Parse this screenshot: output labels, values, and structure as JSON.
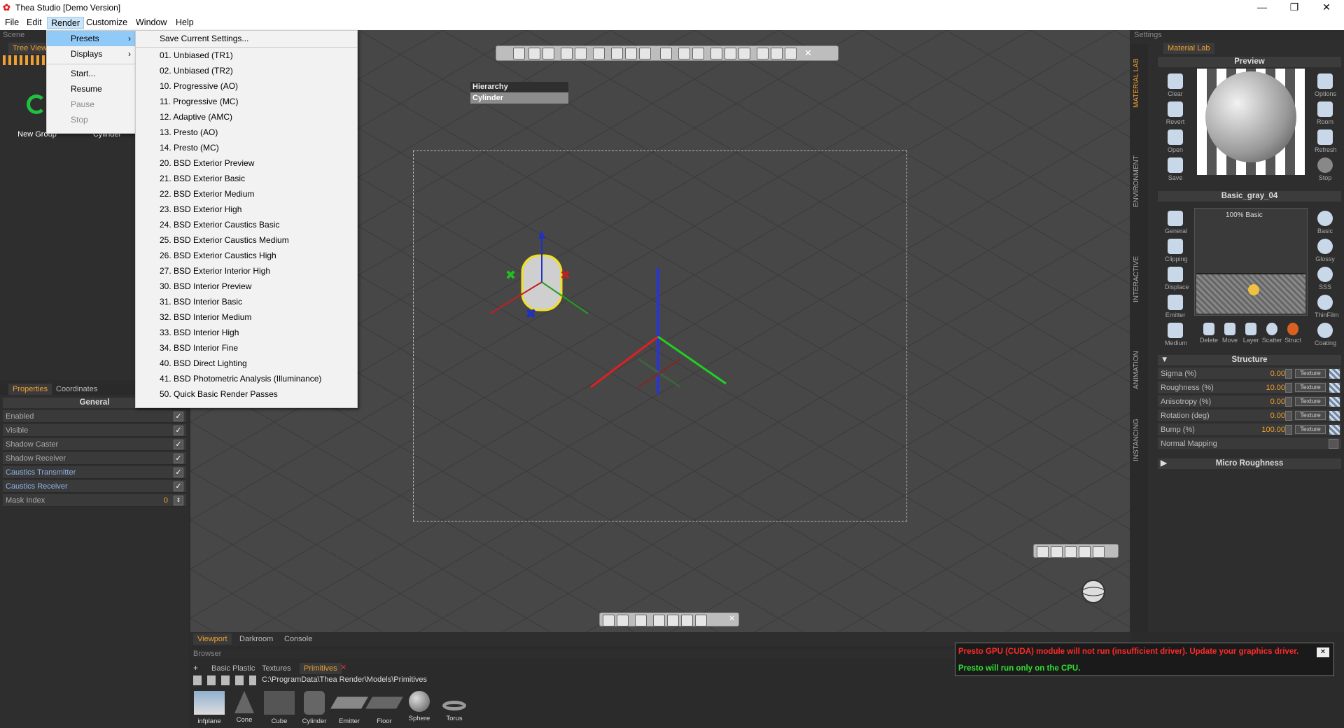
{
  "window": {
    "title": "Thea Studio [Demo Version]"
  },
  "menubar": {
    "items": [
      "File",
      "Edit",
      "Render",
      "Customize",
      "Window",
      "Help"
    ]
  },
  "scene": {
    "header": "Scene",
    "tree_tab": "Tree View",
    "items": [
      "New Group",
      "Cylinder"
    ]
  },
  "properties": {
    "tabs": [
      "Properties",
      "Coordinates"
    ],
    "section": "General",
    "rows": [
      {
        "label": "Enabled",
        "checked": "✓"
      },
      {
        "label": "Visible",
        "checked": "✓"
      },
      {
        "label": "Shadow Caster",
        "checked": "✓"
      },
      {
        "label": "Shadow Receiver",
        "checked": "✓"
      },
      {
        "label": "Caustics Transmitter",
        "checked": "✓"
      },
      {
        "label": "Caustics Receiver",
        "checked": "✓"
      }
    ],
    "mask_label": "Mask Index",
    "mask_value": "0"
  },
  "render_menu": {
    "items": [
      {
        "label": "Presets",
        "arrow": "›"
      },
      {
        "label": "Displays",
        "arrow": "›"
      },
      {
        "label": "Start..."
      },
      {
        "label": "Resume"
      },
      {
        "label": "Pause"
      },
      {
        "label": "Stop"
      }
    ]
  },
  "presets_menu": {
    "items": [
      "Save Current Settings...",
      "01. Unbiased (TR1)",
      "02. Unbiased (TR2)",
      "10. Progressive (AO)",
      "11. Progressive (MC)",
      "12. Adaptive (AMC)",
      "13. Presto (AO)",
      "14. Presto (MC)",
      "20. BSD Exterior Preview",
      "21. BSD Exterior Basic",
      "22. BSD Exterior Medium",
      "23. BSD Exterior High",
      "24. BSD Exterior Caustics Basic",
      "25. BSD Exterior Caustics Medium",
      "26. BSD Exterior Caustics High",
      "27. BSD Exterior Interior High",
      "30. BSD Interior Preview",
      "31. BSD Interior Basic",
      "32. BSD Interior Medium",
      "33. BSD Interior High",
      "34. BSD Interior Fine",
      "40. BSD Direct Lighting",
      "41. BSD Photometric Analysis (Illuminance)",
      "50. Quick Basic Render Passes"
    ]
  },
  "viewport": {
    "hierarchy_title": "Hierarchy",
    "hierarchy_item": "Cylinder",
    "tabs": [
      "Viewport",
      "Darkroom",
      "Console"
    ]
  },
  "settings": {
    "header": "Settings",
    "vtabs": [
      "MATERIAL LAB",
      "ENVIRONMENT",
      "INTERACTIVE",
      "ANIMATION",
      "INSTANCING"
    ],
    "material_tab": "Material Lab",
    "preview_title": "Preview",
    "left_buttons": [
      "Clear",
      "Revert",
      "Open",
      "Save"
    ],
    "right_buttons": [
      "Options",
      "Room",
      "Refresh",
      "Stop"
    ],
    "material_name": "Basic_gray_04",
    "layer_label": "100% Basic",
    "layer_left": [
      "General",
      "Clipping",
      "Displace",
      "Emitter",
      "Medium"
    ],
    "layer_right": [
      "Basic",
      "Glossy",
      "SSS",
      "ThinFilm",
      "Coating"
    ],
    "layer_bottom": [
      "Delete",
      "Move",
      "Layer",
      "Scatter",
      "Struct"
    ],
    "structure_title": "Structure",
    "structure": [
      {
        "label": "Sigma (%)",
        "value": "0.00",
        "tex": "Texture"
      },
      {
        "label": "Roughness (%)",
        "value": "10.00",
        "tex": "Texture"
      },
      {
        "label": "Anisotropy (%)",
        "value": "0.00",
        "tex": "Texture"
      },
      {
        "label": "Rotation (deg)",
        "value": "0.00",
        "tex": "Texture"
      },
      {
        "label": "Bump (%)",
        "value": "100.00",
        "tex": "Texture"
      }
    ],
    "normal_mapping": "Normal Mapping",
    "micro_roughness": "Micro Roughness"
  },
  "browser": {
    "header": "Browser",
    "tabs": [
      "Basic Plastic",
      "Textures",
      "Primitives"
    ],
    "path": "C:\\ProgramData\\Thea Render\\Models\\Primitives",
    "items": [
      "infplane",
      "Cone",
      "Cube",
      "Cylinder",
      "Emitter",
      "Floor",
      "Sphere",
      "Torus"
    ]
  },
  "notice": {
    "line1": "Presto GPU (CUDA) module will not run (insufficient driver). Update your graphics driver.",
    "line2": "Presto will run only on the CPU.",
    "close": "✕"
  }
}
